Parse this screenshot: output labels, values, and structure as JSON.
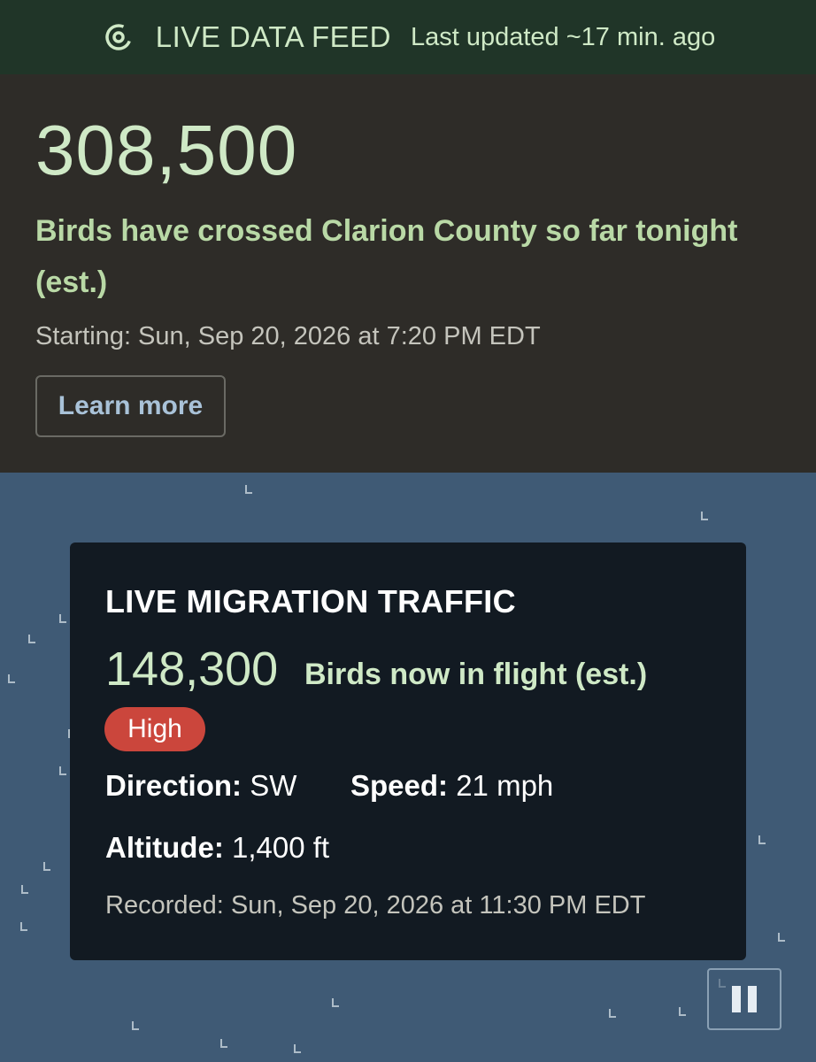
{
  "feed_bar": {
    "icon": "radio-signal-icon",
    "label": "LIVE DATA FEED",
    "updated": "Last updated ~17 min. ago"
  },
  "summary": {
    "count": "308,500",
    "description": "Birds have crossed Clarion County so far tonight (est.)",
    "starting": "Starting: Sun, Sep 20, 2026 at 7:20 PM EDT",
    "learn_more": "Learn more"
  },
  "traffic": {
    "title": "LIVE MIGRATION TRAFFIC",
    "count": "148,300",
    "in_flight": "Birds now in flight (est.)",
    "level": "High",
    "level_color": "#cb463c",
    "direction_label": "Direction:",
    "direction_value": "SW",
    "speed_label": "Speed:",
    "speed_value": "21 mph",
    "altitude_label": "Altitude:",
    "altitude_value": "1,400 ft",
    "recorded": "Recorded: Sun, Sep 20, 2026 at 11:30 PM EDT"
  },
  "map": {
    "background": "#3f5a75",
    "marker_icon": "bird-arrow-icon",
    "pause_icon": "pause-icon"
  }
}
